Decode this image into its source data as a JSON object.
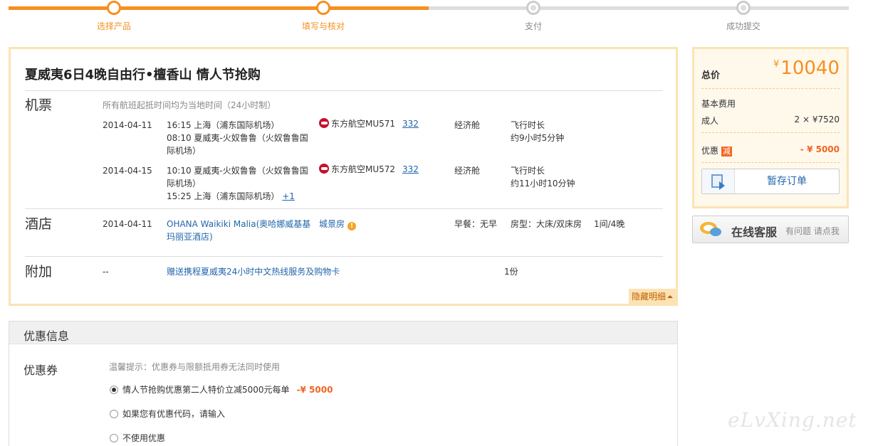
{
  "steps": [
    {
      "label": "选择产品"
    },
    {
      "label": "填写与核对"
    },
    {
      "label": "支付"
    },
    {
      "label": "成功提交"
    }
  ],
  "detail": {
    "title": "夏威夷6日4晚自由行•檀香山 情人节抢购",
    "flights": {
      "label": "机票",
      "note": "所有航班起抵时间均为当地时间（24小时制）",
      "items": [
        {
          "date": "2014-04-11",
          "depart": "16:15 上海（浦东国际机场）",
          "arrive": "08:10 夏威夷-火奴鲁鲁（火奴鲁鲁国际机场）",
          "airline": "东方航空MU571",
          "aircraft": "332",
          "cabin": "经济舱",
          "duration_label": "飞行时长",
          "duration": "约9小时5分钟"
        },
        {
          "date": "2014-04-15",
          "depart": "10:10 夏威夷-火奴鲁鲁（火奴鲁鲁国际机场）",
          "arrive": "15:25 上海（浦东国际机场）",
          "plus_day": "+1",
          "airline": "东方航空MU572",
          "aircraft": "332",
          "cabin": "经济舱",
          "duration_label": "飞行时长",
          "duration": "约11小时10分钟"
        }
      ]
    },
    "hotel": {
      "label": "酒店",
      "date": "2014-04-11",
      "name": "OHANA Waikiki Malia(奥哈娜威基基玛丽亚酒店)",
      "room_view": "城景房",
      "breakfast": "早餐：无早",
      "room_type": "房型：大床/双床房",
      "quantity": "1间/4晚"
    },
    "extra": {
      "label": "附加",
      "date": "--",
      "item": "赠送携程夏威夷24小时中文热线服务及购物卡",
      "quantity": "1份"
    },
    "hide_detail": "隐藏明细"
  },
  "price": {
    "total_label": "总价",
    "currency": "¥",
    "total": "10040",
    "base_label": "基本费用",
    "adult_label": "成人",
    "adult_price": "2 × ¥7520",
    "discount_label": "优惠",
    "discount_badge": "减",
    "discount_value": "- ¥ 5000",
    "save_button": "暂存订单"
  },
  "service": {
    "main": "在线客服",
    "sub": "有问题 请点我"
  },
  "discount": {
    "header": "优惠信息",
    "coupon_label": "优惠券",
    "tip": "温馨提示：优惠券与限额抵用券无法同时使用",
    "options": [
      {
        "label": "情人节抢购优惠第二人特价立减5000元每单",
        "amount": "-¥ 5000",
        "selected": true
      },
      {
        "label": "如果您有优惠代码，请输入",
        "selected": false
      },
      {
        "label": "不使用优惠",
        "selected": false
      }
    ]
  },
  "watermark": "eLvXing.net",
  "colors": {
    "accent": "#f78f1e",
    "border": "#fce3b4",
    "link": "#2266aa"
  }
}
